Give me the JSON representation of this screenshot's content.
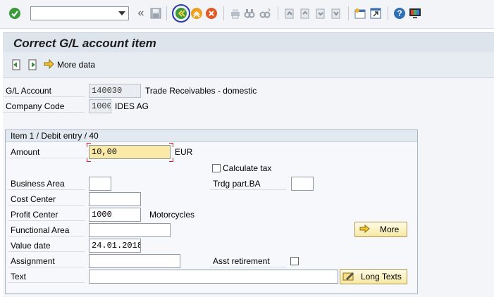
{
  "toolbar": {
    "command_field": "",
    "icons": [
      "check-icon",
      "history-icon",
      "save-icon",
      "back-icon",
      "exit-icon",
      "cancel-icon",
      "print-icon",
      "find-icon",
      "find-next-icon",
      "first-page-icon",
      "previous-page-icon",
      "next-page-icon",
      "last-page-icon",
      "new-session-icon",
      "shortcut-icon",
      "help-icon",
      "customize-layout-icon"
    ]
  },
  "title": "Correct G/L account item",
  "app_toolbar": {
    "more_data_label": "More data"
  },
  "header": {
    "gl_account_label": "G/L Account",
    "gl_account_value": "140030",
    "gl_account_text": "Trade Receivables - domestic",
    "company_code_label": "Company Code",
    "company_code_value": "1000",
    "company_code_text": "IDES AG"
  },
  "item": {
    "group_title": "Item 1 / Debit entry / 40",
    "amount_label": "Amount",
    "amount_value": "10,00",
    "currency": "EUR",
    "calculate_tax_label": "Calculate tax",
    "calculate_tax_checked": false,
    "business_area_label": "Business Area",
    "business_area_value": "",
    "trdg_part_ba_label": "Trdg part.BA",
    "trdg_part_ba_value": "",
    "cost_center_label": "Cost Center",
    "cost_center_value": "",
    "profit_center_label": "Profit Center",
    "profit_center_value": "1000",
    "profit_center_text": "Motorcycles",
    "functional_area_label": "Functional Area",
    "functional_area_value": "",
    "more_button": "More",
    "value_date_label": "Value date",
    "value_date_value": "24.01.2018",
    "assignment_label": "Assignment",
    "assignment_value": "",
    "asst_retirement_label": "Asst retirement",
    "asst_retirement_checked": false,
    "text_label": "Text",
    "text_value": "",
    "long_texts_button": "Long Texts"
  },
  "colors": {
    "toolbar_bg": "#f2f4f7",
    "title_bg": "#dde4ec",
    "required_field_bg": "#fbe9a8",
    "button_border": "#a69458"
  }
}
